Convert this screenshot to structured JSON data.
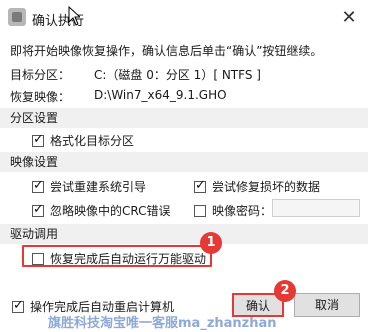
{
  "window": {
    "title": "确认执行",
    "close_symbol": "✕"
  },
  "intro": "即将开始映像恢复操作，确认信息后单击“确认”按钮继续。",
  "info": [
    {
      "label": "目标分区：",
      "value": "C:（磁盘 0：分区 1）[ NTFS ]"
    },
    {
      "label": "恢复映像：",
      "value": "D:\\Win7_x64_9.1.GHO"
    }
  ],
  "sections": {
    "partition": "分区设置",
    "image": "映像设置",
    "driver": "驱动调用"
  },
  "options": {
    "format_partition": {
      "label": "格式化目标分区",
      "checked": true
    },
    "rebuild_boot": {
      "label": "尝试重建系统引导",
      "checked": true
    },
    "repair_data": {
      "label": "尝试修复损坏的数据",
      "checked": true
    },
    "ignore_crc": {
      "label": "忽略映像中的CRC错误",
      "checked": true
    },
    "image_password": {
      "label": "映像密码：",
      "checked": false,
      "value": ""
    },
    "run_driver": {
      "label": "恢复完成后自动运行万能驱动",
      "checked": false
    },
    "auto_restart": {
      "label": "操作完成后自动重启计算机",
      "checked": true
    }
  },
  "buttons": {
    "confirm": "确认",
    "cancel": "取消"
  },
  "annotations": {
    "badge1": "1",
    "badge2": "2"
  },
  "watermark": "旗胜科技淘宝唯一客服ma_zhanzhan",
  "colors": {
    "highlight": "#e53935",
    "section_bg": "#f0f0f0",
    "watermark": "#8da9d8"
  }
}
